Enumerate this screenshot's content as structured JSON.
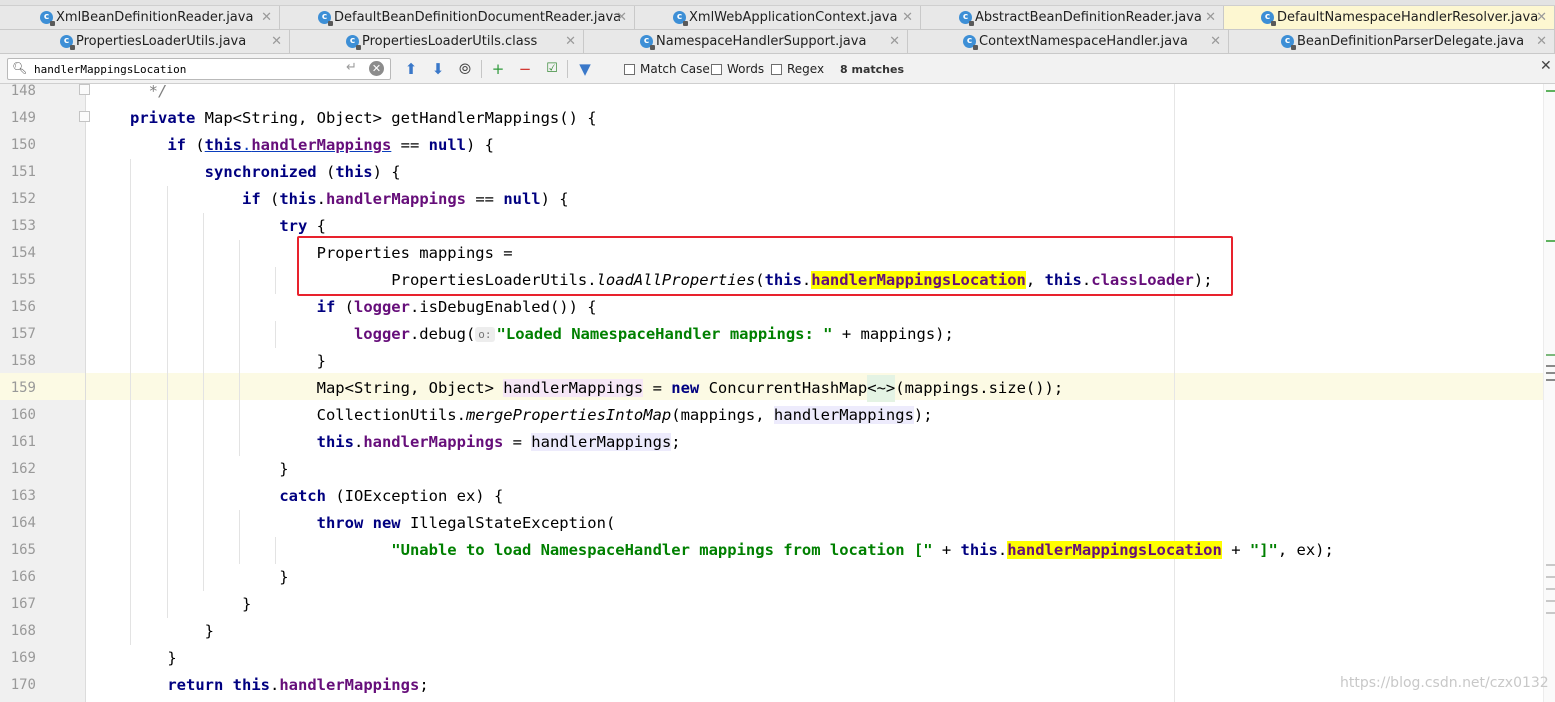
{
  "tabs_row1": [
    {
      "label": "XmlBeanDefinitionReader.java",
      "active": false
    },
    {
      "label": "DefaultBeanDefinitionDocumentReader.java",
      "active": false
    },
    {
      "label": "XmlWebApplicationContext.java",
      "active": false
    },
    {
      "label": "AbstractBeanDefinitionReader.java",
      "active": false
    },
    {
      "label": "DefaultNamespaceHandlerResolver.java",
      "active": true
    }
  ],
  "tabs_row2": [
    {
      "label": "PropertiesLoaderUtils.java"
    },
    {
      "label": "PropertiesLoaderUtils.class"
    },
    {
      "label": "NamespaceHandlerSupport.java"
    },
    {
      "label": "ContextNamespaceHandler.java"
    },
    {
      "label": "BeanDefinitionParserDelegate.java"
    }
  ],
  "icons": {
    "tab_file": "class-file-icon",
    "close": "close-icon",
    "search": "search-icon",
    "enter": "enter-icon",
    "clear": "clear-icon",
    "up": "arrow-up-icon",
    "down": "arrow-down-icon",
    "find_all": "find-all-icon",
    "add_occ": "add-occurrence-icon",
    "remove_occ": "remove-occurrence-icon",
    "select_all": "select-all-occurrences-icon",
    "filter": "filter-icon"
  },
  "search": {
    "query": "handlerMappingsLocation",
    "match_case": "Match Case",
    "words": "Words",
    "regex": "Regex",
    "matches": "8 matches"
  },
  "editor": {
    "current_line": 159,
    "lines": [
      {
        "n": 148,
        "html": "  <span class=\"cm\">*/</span>"
      },
      {
        "n": 149,
        "html": "<span class=\"k\">private</span> Map&lt;String, Object&gt; getHandlerMappings() {"
      },
      {
        "n": 150,
        "html": "    <span class=\"k\">if</span> (<span class=\"u\"><span class=\"k\">this</span>.<span class=\"f\">handlerMappings</span></span> == <span class=\"k\">null</span>) {"
      },
      {
        "n": 151,
        "html": "        <span class=\"k\">synchronized</span> (<span class=\"k\">this</span>) {"
      },
      {
        "n": 152,
        "html": "            <span class=\"k\">if</span> (<span class=\"k\">this</span>.<span class=\"f\">handlerMappings</span> == <span class=\"k\">null</span>) {"
      },
      {
        "n": 153,
        "html": "                <span class=\"k\">try</span> {"
      },
      {
        "n": 154,
        "html": "                    Properties mappings ="
      },
      {
        "n": 155,
        "html": "                            PropertiesLoaderUtils.<span class=\"i\">loadAllProperties</span>(<span class=\"k\">this</span>.<span class=\"f hl\">handlerMappingsLocation</span>, <span class=\"k\">this</span>.<span class=\"f\">classLoader</span>);"
      },
      {
        "n": 156,
        "html": "                    <span class=\"k\">if</span> (<span class=\"f\">logger</span>.isDebugEnabled()) {"
      },
      {
        "n": 157,
        "html": "                        <span class=\"f\">logger</span>.debug(<span class=\"hint\">o:</span><span class=\"s\">\"Loaded NamespaceHandler mappings: \"</span> + mappings);"
      },
      {
        "n": 158,
        "html": "                    }"
      },
      {
        "n": 159,
        "html": "                    Map&lt;String, Object&gt; <span class=\"lvw\">handlerMappings</span> = <span class=\"k\">new</span> ConcurrentHashMap<span class=\"diamond\">&lt;~&gt;</span>(mappings.size());"
      },
      {
        "n": 160,
        "html": "                    CollectionUtils.<span class=\"i\">mergePropertiesIntoMap</span>(mappings, <span class=\"lv\">handlerMappings</span>);"
      },
      {
        "n": 161,
        "html": "                    <span class=\"k\">this</span>.<span class=\"f\">handlerMappings</span> = <span class=\"lv\">handlerMappings</span>;"
      },
      {
        "n": 162,
        "html": "                }"
      },
      {
        "n": 163,
        "html": "                <span class=\"k\">catch</span> (IOException ex) {"
      },
      {
        "n": 164,
        "html": "                    <span class=\"k\">throw new</span> IllegalStateException("
      },
      {
        "n": 165,
        "html": "                            <span class=\"s\">\"Unable to load NamespaceHandler mappings from location [\"</span> + <span class=\"k\">this</span>.<span class=\"f hl\">handlerMappingsLocation</span> + <span class=\"s\">\"]\"</span>, ex);"
      },
      {
        "n": 166,
        "html": "                }"
      },
      {
        "n": 167,
        "html": "            }"
      },
      {
        "n": 168,
        "html": "        }"
      },
      {
        "n": 169,
        "html": "    }"
      },
      {
        "n": 170,
        "html": "    <span class=\"k\">return this</span>.<span class=\"f\">handlerMappings</span>;"
      }
    ]
  },
  "colors": {
    "match_highlight": "#ffff00",
    "annotation_box": "#e8222d",
    "current_line": "#fcfae4"
  },
  "watermark": "https://blog.csdn.net/czx0132"
}
